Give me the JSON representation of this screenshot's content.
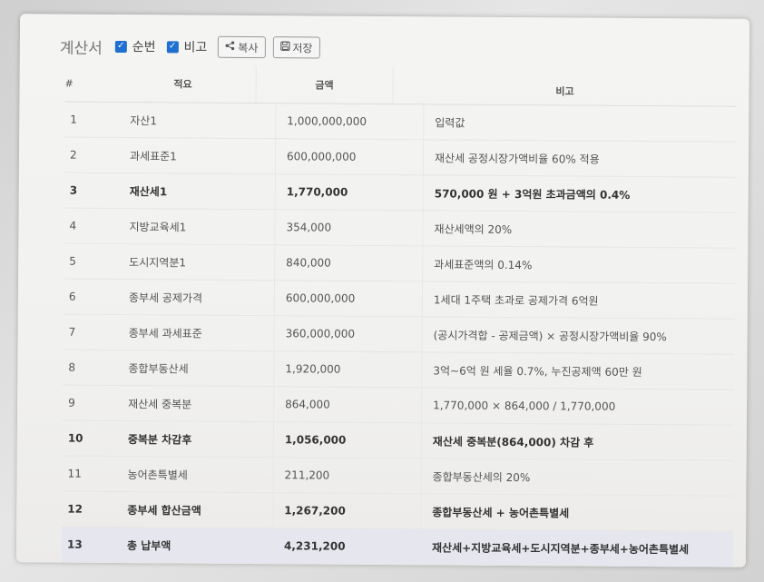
{
  "toolbar": {
    "title": "계산서",
    "checkboxes": [
      {
        "label": "순번",
        "checked": true
      },
      {
        "label": "비고",
        "checked": true
      }
    ],
    "copy_label": "복사",
    "save_label": "저장",
    "accent_color": "#1f6fd1"
  },
  "table": {
    "headers": {
      "num": "#",
      "item": "적요",
      "amount": "금액",
      "note": "비고"
    },
    "rows": [
      {
        "num": "1",
        "item": "자산1",
        "amount": "1,000,000,000",
        "note": "입력값",
        "bold": false
      },
      {
        "num": "2",
        "item": "과세표준1",
        "amount": "600,000,000",
        "note": "재산세 공정시장가액비율 60% 적용",
        "bold": false
      },
      {
        "num": "3",
        "item": "재산세1",
        "amount": "1,770,000",
        "note": "570,000 원 + 3억원 초과금액의 0.4%",
        "bold": true
      },
      {
        "num": "4",
        "item": "지방교육세1",
        "amount": "354,000",
        "note": "재산세액의 20%",
        "bold": false
      },
      {
        "num": "5",
        "item": "도시지역분1",
        "amount": "840,000",
        "note": "과세표준액의 0.14%",
        "bold": false
      },
      {
        "num": "6",
        "item": "종부세 공제가격",
        "amount": "600,000,000",
        "note": "1세대 1주택 초과로 공제가격 6억원",
        "bold": false
      },
      {
        "num": "7",
        "item": "종부세 과세표준",
        "amount": "360,000,000",
        "note": "(공시가격합 - 공제금액) × 공정시장가액비율 90%",
        "bold": false
      },
      {
        "num": "8",
        "item": "종합부동산세",
        "amount": "1,920,000",
        "note": "3억~6억 원 세율 0.7%, 누진공제액 60만 원",
        "bold": false
      },
      {
        "num": "9",
        "item": "재산세 중복분",
        "amount": "864,000",
        "note": "1,770,000 × 864,000 / 1,770,000",
        "bold": false
      },
      {
        "num": "10",
        "item": "중복분 차감후",
        "amount": "1,056,000",
        "note": "재산세 중복분(864,000) 차감 후",
        "bold": true
      },
      {
        "num": "11",
        "item": "농어촌특별세",
        "amount": "211,200",
        "note": "종합부동산세의 20%",
        "bold": false
      },
      {
        "num": "12",
        "item": "종부세 합산금액",
        "amount": "1,267,200",
        "note": "종합부동산세 + 농어촌특별세",
        "bold": true
      },
      {
        "num": "13",
        "item": "총 납부액",
        "amount": "4,231,200",
        "note": "재산세+지방교육세+도시지역분+종부세+농어촌특별세",
        "bold": true,
        "highlight": true
      }
    ]
  }
}
